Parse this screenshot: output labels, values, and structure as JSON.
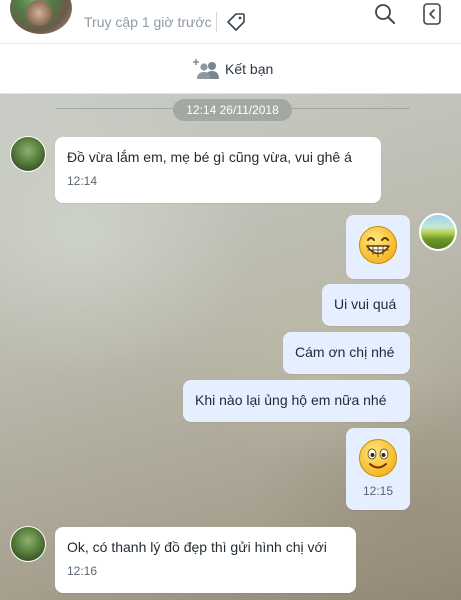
{
  "header": {
    "last_seen": "Truy cập 1 giờ trước"
  },
  "friend_bar": {
    "add_friend_label": "Kết bạn"
  },
  "chat": {
    "date_separator": "12:14 26/11/2018",
    "messages": [
      {
        "from": "contact",
        "text": "Đồ vừa lắm em, mẹ bé gì cũng vừa, vui  ghê á",
        "time": "12:14"
      },
      {
        "from": "me",
        "emoji": "grinning-face",
        "text": "",
        "time": ""
      },
      {
        "from": "me",
        "text": "Ui vui quá",
        "time": ""
      },
      {
        "from": "me",
        "text": "Cám ơn chị nhé",
        "time": ""
      },
      {
        "from": "me",
        "text": "Khi nào lại ủng hộ em nữa nhé",
        "time": ""
      },
      {
        "from": "me",
        "emoji": "smiling-face",
        "text": "",
        "time": "12:15"
      },
      {
        "from": "contact",
        "text": "Ok, có thanh lý đồ đẹp thì gửi hình chị với",
        "time": "12:16"
      }
    ]
  },
  "colors": {
    "outgoing_bubble": "#e5efff",
    "incoming_bubble": "#ffffff",
    "date_pill": "#a4a8a3"
  },
  "icons": [
    "tag-icon",
    "search-icon",
    "panel-toggle-icon",
    "add-friend-icon",
    "grinning-emoji-icon",
    "smiling-emoji-icon"
  ]
}
